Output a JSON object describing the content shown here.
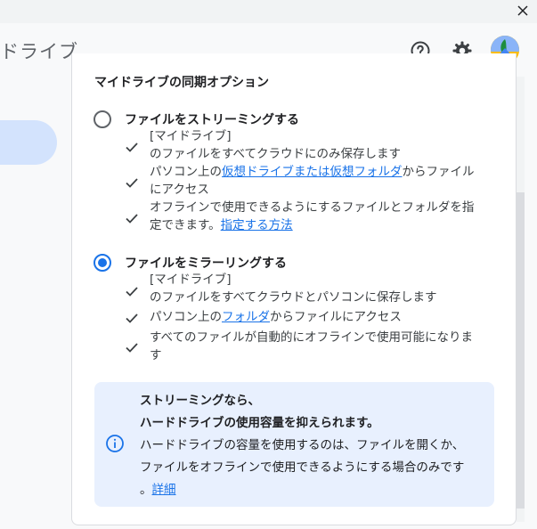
{
  "window": {
    "close_icon": "close-icon"
  },
  "header": {
    "title": "ドライブ",
    "help_icon": "help-icon",
    "settings_icon": "gear-icon",
    "avatar_icon": "avatar"
  },
  "section_title": "マイドライブの同期オプション",
  "options": [
    {
      "label": "ファイルをストリーミングする",
      "selected": false,
      "bullets": [
        {
          "l1": "[マイドライブ]",
          "l2": "のファイルをすべてクラウドにのみ保存します"
        },
        {
          "pre": "パソコン上の",
          "link": "仮想ドライブまたは仮想フォルダ",
          "post": "からファイル",
          "l2": "にアクセス"
        },
        {
          "l1": "オフラインで使用できるようにするファイルとフォルダを指",
          "pre": "定できます。",
          "link": "指定する方法"
        }
      ]
    },
    {
      "label": "ファイルをミラーリングする",
      "selected": true,
      "bullets": [
        {
          "l1": "[マイドライブ]",
          "l2": "のファイルをすべてクラウドとパソコンに保存します"
        },
        {
          "pre": "パソコン上の",
          "link": "フォルダ",
          "post": "からファイルにアクセス"
        },
        {
          "l1": "すべてのファイルが自動的にオフラインで使用可能になりま",
          "l2": "す"
        }
      ]
    }
  ],
  "info": {
    "title1": "ストリーミングなら、",
    "title2": "ハードドライブの使用容量を抑えられます。",
    "body1": "ハードドライブの容量を使用するのは、ファイルを開くか、",
    "body2": "ファイルをオフラインで使用できるようにする場合のみです",
    "body3_pre": "。",
    "link": "詳細"
  }
}
